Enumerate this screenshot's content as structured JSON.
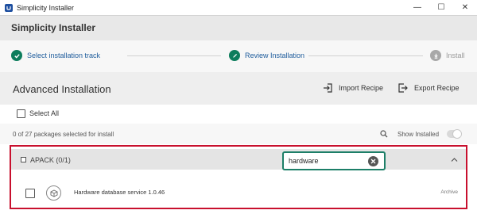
{
  "window": {
    "title": "Simplicity Installer",
    "controls": {
      "minimize": "—",
      "maximize": "☐",
      "close": "✕"
    }
  },
  "header": {
    "title": "Simplicity Installer"
  },
  "steps": [
    {
      "label": "Select installation track",
      "icon": "check-icon",
      "state": "done"
    },
    {
      "label": "Review Installation",
      "icon": "pencil-icon",
      "state": "current"
    },
    {
      "label": "Install",
      "icon": "download-icon",
      "state": "pending"
    }
  ],
  "advanced": {
    "title": "Advanced Installation",
    "import_label": "Import Recipe",
    "export_label": "Export Recipe"
  },
  "select_all": {
    "label": "Select All",
    "checked": false
  },
  "packages_bar": {
    "count_text": "0 of 27 packages selected for install",
    "show_installed_label": "Show Installed",
    "show_installed_on": false
  },
  "search": {
    "value": "hardware"
  },
  "group": {
    "label": "APACK (0/1)",
    "expanded": true
  },
  "packages": [
    {
      "name": "Hardware database service 1.0.46",
      "tag": "Archive",
      "checked": false
    }
  ],
  "colors": {
    "accent": "#0d7d5c",
    "link": "#1e5c9c",
    "highlight": "#c8102e",
    "search_border": "#1d7f68"
  }
}
